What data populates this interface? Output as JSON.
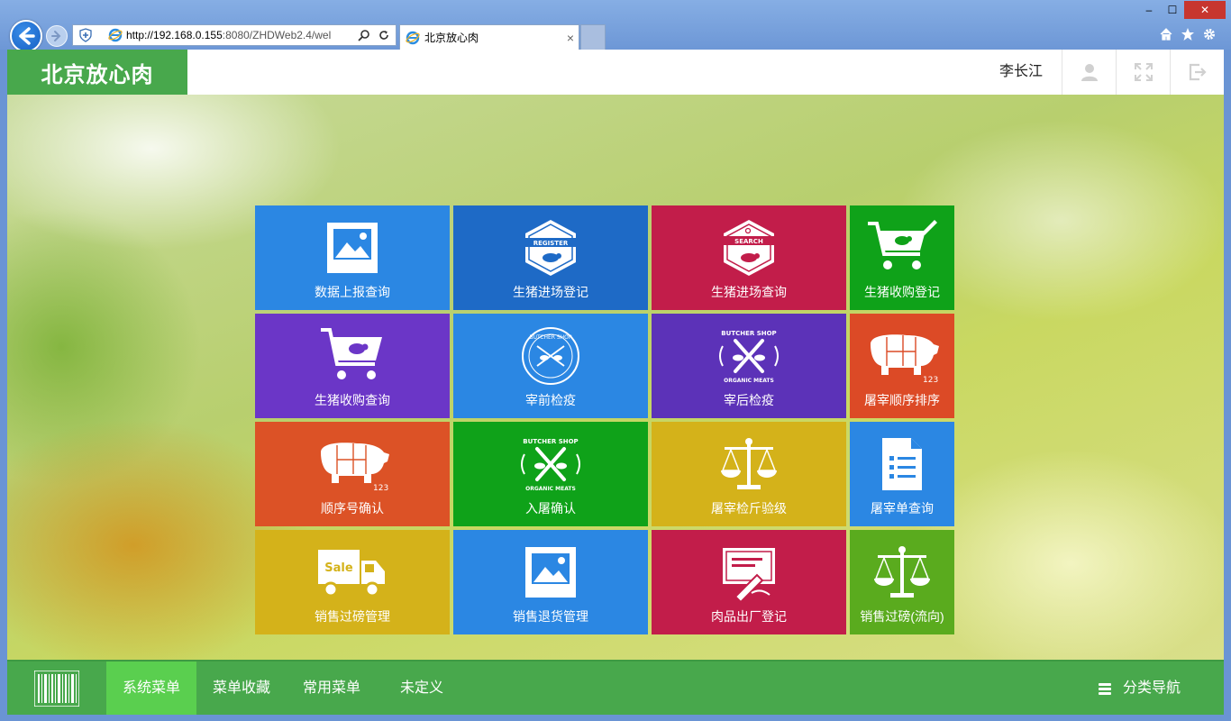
{
  "browser": {
    "url_host": "http://192.168.0.155",
    "url_rest": ":8080/ZHDWeb2.4/wel",
    "tab_title": "北京放心肉",
    "tab_close": "×",
    "win_min": "‒",
    "win_max": "☐",
    "win_close": "✕"
  },
  "header": {
    "brand": "北京放心肉",
    "username": "李长江"
  },
  "tiles": [
    {
      "label": "数据上报查询",
      "color": "#2b87e3",
      "icon": "image-icon"
    },
    {
      "label": "生猪进场登记",
      "color": "#1e6ac6",
      "icon": "register-badge-icon",
      "badge_text": "REGISTER"
    },
    {
      "label": "生猪进场查询",
      "color": "#c21d4a",
      "icon": "search-badge-icon",
      "badge_text": "SEARCH"
    },
    {
      "label": "生猪收购登记",
      "color": "#0fa219",
      "icon": "cart-edit-icon"
    },
    {
      "label": "生猪收购查询",
      "color": "#6b36c7",
      "icon": "cart-pig-icon"
    },
    {
      "label": "宰前检疫",
      "color": "#2b87e3",
      "icon": "butcher-badge-icon",
      "badge_text": "BUTCHER SHOP"
    },
    {
      "label": "宰后检疫",
      "color": "#5c32b8",
      "icon": "butcher-knives-icon",
      "badge_text": "BUTCHER SHOP",
      "badge_sub": "ORGANIC MEATS"
    },
    {
      "label": "屠宰顺序排序",
      "color": "#dc4a26",
      "icon": "pig-cuts-icon",
      "badge_text": "123"
    },
    {
      "label": "顺序号确认",
      "color": "#dc5226",
      "icon": "pig-cuts-icon",
      "badge_text": "123"
    },
    {
      "label": "入屠确认",
      "color": "#0fa219",
      "icon": "butcher-knives-icon",
      "badge_text": "BUTCHER SHOP",
      "badge_sub": "ORGANIC MEATS"
    },
    {
      "label": "屠宰检斤验级",
      "color": "#d4b21a",
      "icon": "scale-icon"
    },
    {
      "label": "屠宰单查询",
      "color": "#2b87e3",
      "icon": "document-list-icon"
    },
    {
      "label": "销售过磅管理",
      "color": "#d4b21a",
      "icon": "sale-truck-icon",
      "badge_text": "Sale"
    },
    {
      "label": "销售退货管理",
      "color": "#2b87e3",
      "icon": "image-icon"
    },
    {
      "label": "肉品出厂登记",
      "color": "#c21d4a",
      "icon": "signed-card-icon"
    },
    {
      "label": "销售过磅(流向)",
      "color": "#5aab1e",
      "icon": "scale-icon"
    }
  ],
  "footer": {
    "items": [
      "系统菜单",
      "菜单收藏",
      "常用菜单",
      "未定义"
    ],
    "nav_label": "分类导航"
  }
}
